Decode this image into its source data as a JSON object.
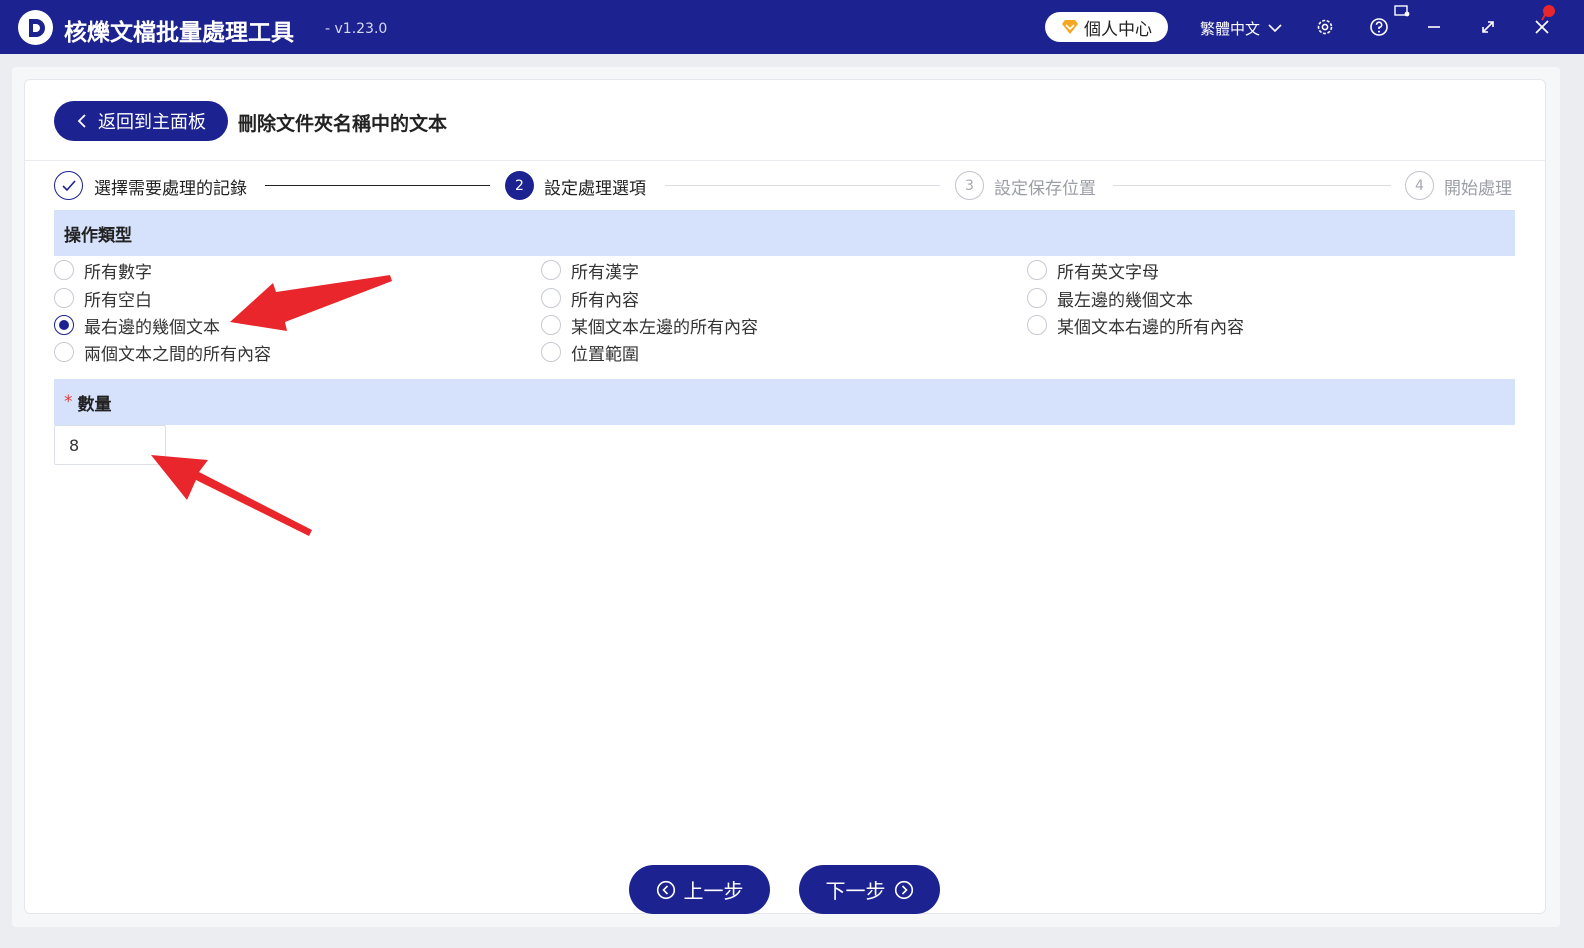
{
  "app": {
    "title": "核爍文檔批量處理工具",
    "version": "- v1.23.0",
    "profile_label": "個人中心",
    "language": "繁體中文"
  },
  "page": {
    "back_label": "返回到主面板",
    "title": "刪除文件夾名稱中的文本"
  },
  "steps": [
    {
      "num": "✓",
      "label": "選擇需要處理的記錄",
      "state": "done"
    },
    {
      "num": "2",
      "label": "設定處理選項",
      "state": "active"
    },
    {
      "num": "3",
      "label": "設定保存位置",
      "state": "pending"
    },
    {
      "num": "4",
      "label": "開始處理",
      "state": "pending"
    }
  ],
  "operation": {
    "heading": "操作類型",
    "options": [
      {
        "label": "所有數字",
        "checked": false
      },
      {
        "label": "所有漢字",
        "checked": false
      },
      {
        "label": "所有英文字母",
        "checked": false
      },
      {
        "label": "所有空白",
        "checked": false
      },
      {
        "label": "所有內容",
        "checked": false
      },
      {
        "label": "最左邊的幾個文本",
        "checked": false
      },
      {
        "label": "最右邊的幾個文本",
        "checked": true
      },
      {
        "label": "某個文本左邊的所有內容",
        "checked": false
      },
      {
        "label": "某個文本右邊的所有內容",
        "checked": false
      },
      {
        "label": "兩個文本之間的所有內容",
        "checked": false
      },
      {
        "label": "位置範圍",
        "checked": false
      }
    ]
  },
  "quantity": {
    "heading": "數量",
    "required_mark": "*",
    "value": "8"
  },
  "nav": {
    "prev_label": "上一步",
    "next_label": "下一步"
  },
  "colors": {
    "primary": "#1c2290",
    "section_bg": "#d6e2fc",
    "annotation": "#e8262b"
  }
}
